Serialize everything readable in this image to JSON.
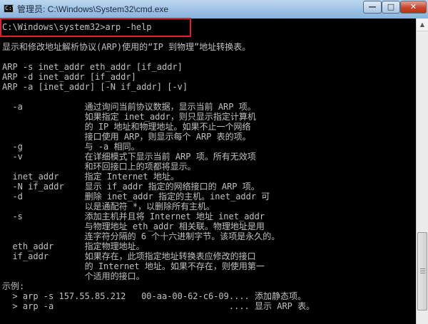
{
  "window": {
    "title": "管理员: C:\\Windows\\System32\\cmd.exe",
    "icon": "cmd-icon",
    "buttons": {
      "minimize": "—",
      "maximize": "□",
      "close": "✕"
    }
  },
  "console": {
    "lines": [
      "C:\\Windows\\system32>arp -help",
      "",
      "显示和修改地址解析协议(ARP)使用的“IP 到物理”地址转换表。",
      "",
      "ARP -s inet_addr eth_addr [if_addr]",
      "ARP -d inet_addr [if_addr]",
      "ARP -a [inet_addr] [-N if_addr] [-v]",
      "",
      "  -a            通过询问当前协议数据，显示当前 ARP 项。",
      "                如果指定 inet_addr，则只显示指定计算机",
      "                的 IP 地址和物理地址。如果不止一个网络",
      "                接口使用 ARP，则显示每个 ARP 表的项。",
      "  -g            与 -a 相同。",
      "  -v            在详细模式下显示当前 ARP 项。所有无效项",
      "                和环回接口上的项都将显示。",
      "  inet_addr     指定 Internet 地址。",
      "  -N if_addr    显示 if_addr 指定的网络接口的 ARP 项。",
      "  -d            删除 inet_addr 指定的主机。inet_addr 可",
      "                以是通配符 *，以删除所有主机。",
      "  -s            添加主机并且将 Internet 地址 inet_addr",
      "                与物理地址 eth_addr 相关联。物理地址是用",
      "                连字符分隔的 6 个十六进制字节。该项是永久的。",
      "  eth_addr      指定物理地址。",
      "  if_addr       如果存在，此项指定地址转换表应修改的接口",
      "                的 Internet 地址。如果不存在，则使用第一",
      "                个适用的接口。",
      "示例:",
      "  > arp -s 157.55.85.212   00-aa-00-62-c6-09.... 添加静态项。",
      "  > arp -a                                  .... 显示 ARP 表。"
    ]
  }
}
